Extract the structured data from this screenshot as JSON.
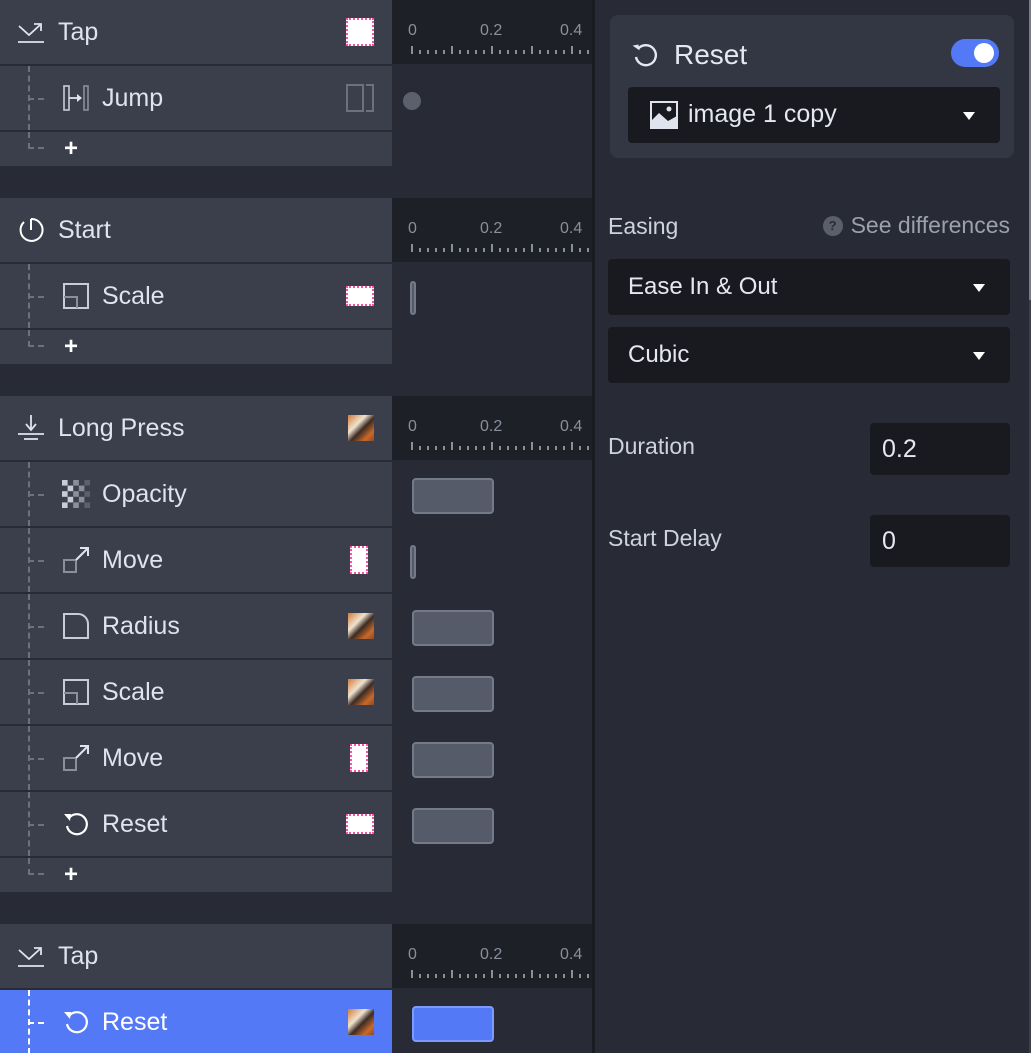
{
  "ruler": {
    "ticks": [
      "0",
      "0.2",
      "0.4"
    ]
  },
  "groups": [
    {
      "trigger": "Tap",
      "icon": "tap-icon",
      "thumb": "white-square",
      "actions": [
        {
          "label": "Jump",
          "icon": "jump-icon",
          "thumb": "outline-split",
          "timeline": "dot"
        }
      ],
      "add_label": "+"
    },
    {
      "trigger": "Start",
      "icon": "start-icon",
      "thumb": "none",
      "actions": [
        {
          "label": "Scale",
          "icon": "scale-icon",
          "thumb": "white-wide",
          "timeline": "pin"
        }
      ],
      "add_label": "+"
    },
    {
      "trigger": "Long Press",
      "icon": "long-press-icon",
      "thumb": "photo",
      "actions": [
        {
          "label": "Opacity",
          "icon": "opacity-icon",
          "thumb": "none",
          "timeline": "bar",
          "duration": 0.2,
          "delay": 0
        },
        {
          "label": "Move",
          "icon": "move-icon",
          "thumb": "white-tall",
          "timeline": "pin"
        },
        {
          "label": "Radius",
          "icon": "radius-icon",
          "thumb": "photo",
          "timeline": "bar",
          "duration": 0.2,
          "delay": 0
        },
        {
          "label": "Scale",
          "icon": "scale-icon",
          "thumb": "photo",
          "timeline": "bar",
          "duration": 0.2,
          "delay": 0
        },
        {
          "label": "Move",
          "icon": "move-icon",
          "thumb": "white-tall",
          "timeline": "bar",
          "duration": 0.2,
          "delay": 0
        },
        {
          "label": "Reset",
          "icon": "reset-icon",
          "thumb": "white-wide",
          "timeline": "bar",
          "duration": 0.2,
          "delay": 0
        }
      ],
      "add_label": "+"
    },
    {
      "trigger": "Tap",
      "icon": "tap-icon",
      "thumb": "none",
      "actions": [
        {
          "label": "Reset",
          "icon": "reset-icon",
          "thumb": "photo",
          "timeline": "bar",
          "duration": 0.2,
          "delay": 0,
          "selected": true
        }
      ]
    }
  ],
  "inspector": {
    "title": "Reset",
    "enabled": true,
    "layer": "image 1 copy",
    "easing_label": "Easing",
    "help_label": "See differences",
    "easing_type": "Ease In & Out",
    "easing_curve": "Cubic",
    "duration_label": "Duration",
    "duration_value": "0.2",
    "delay_label": "Start Delay",
    "delay_value": "0"
  },
  "colors": {
    "accent": "#5479f7",
    "row_bg": "#3a3f4b",
    "panel_bg": "#282b36",
    "input_bg": "#181a1f"
  }
}
